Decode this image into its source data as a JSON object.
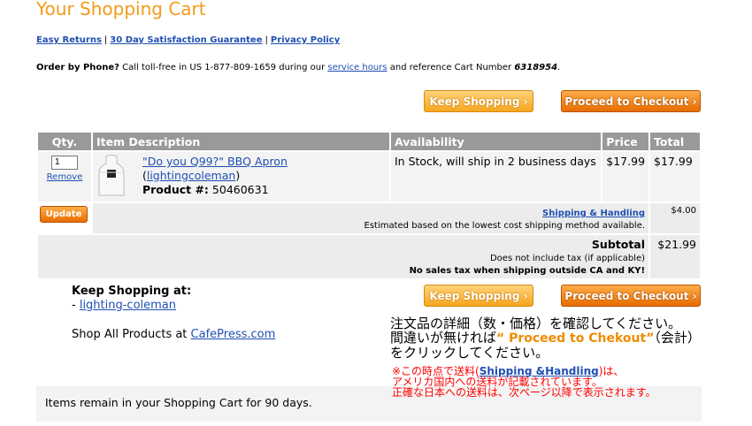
{
  "header": {
    "title": "Your Shopping Cart",
    "links": [
      "Easy Returns",
      "30 Day Satisfaction Guarantee",
      "Privacy Policy"
    ],
    "separator": "|"
  },
  "order_by_phone": {
    "label": "Order by Phone?",
    "text_before": " Call toll-free in US 1-877-809-1659 during our ",
    "service_hours_link": "service hours",
    "text_after": " and reference Cart Number ",
    "cart_number": "6318954",
    "end": "."
  },
  "buttons": {
    "keep_shopping": "Keep Shopping ›",
    "proceed_checkout": "Proceed to Checkout ›",
    "update": "Update"
  },
  "table": {
    "headers": [
      "Qty.",
      "Item Description",
      "Availability",
      "Price",
      "Total"
    ],
    "items": [
      {
        "qty": "1",
        "remove": "Remove",
        "name": "\"Do you Q99?\" BBQ Apron",
        "shop_open": "(",
        "shop": "lightingcoleman",
        "shop_close": ")",
        "product_label": "Product #:",
        "product_number": "50460631",
        "availability": "In Stock, will ship in 2 business days",
        "price": "$17.99",
        "total": "$17.99"
      }
    ],
    "shipping": {
      "label": "Shipping & Handling",
      "note": "Estimated based on the lowest cost shipping method available.",
      "amount": "$4.00"
    },
    "subtotal": {
      "label": "Subtotal",
      "tax_note": "Does not include tax (if applicable)",
      "tax_note2": "No sales tax when shipping outside CA and KY!",
      "amount": "$21.99"
    }
  },
  "keep_shopping_at": {
    "heading": "Keep Shopping at:",
    "dash": "- ",
    "shop_link": "lighting-coleman",
    "shop_all_text": "Shop All Products at ",
    "cafepress_link": "CafePress.com"
  },
  "footer": {
    "text": "Items remain in your Shopping Cart for 90 days."
  },
  "annotation": {
    "line1": "注文品の詳細（数・価格）を確認してください。",
    "line2_before": "間違いが無ければ",
    "line2_highlight": "“ Proceed to Chekout”",
    "line2_after": "（会計）",
    "line3": "をクリックしてください。",
    "note1_before": "※この時点で送料(",
    "note1_link": "Shipping &Handling",
    "note1_after": ")は、",
    "note2": "アメリカ国内への送料が記載されています。",
    "note3": "正確な日本への送料は、次ページ以降で表示されます。"
  }
}
